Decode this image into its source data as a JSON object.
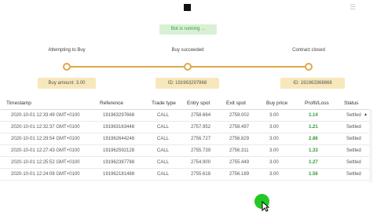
{
  "toolbar": {
    "stop_icon": "stop-square-icon",
    "corner_icon": "settings-icon",
    "corner_glyph": "☰"
  },
  "status": {
    "label": "Bot is running ..."
  },
  "steps": [
    {
      "title": "Attempting to Buy",
      "box": "Buy amount: 3.00"
    },
    {
      "title": "Buy succeeded",
      "box": "ID: 191963297868"
    },
    {
      "title": "Contract closed",
      "box": "ID: 191963368868"
    }
  ],
  "table": {
    "headers": [
      "Timestamp",
      "Reference",
      "Trade type",
      "Entry spot",
      "Exit spot",
      "Buy price",
      "Profit/Loss",
      "Status"
    ],
    "rows": [
      [
        "2020-10-01 12:33:49 GMT+0100",
        "191963297668",
        "CALL",
        "2758.664",
        "2759.002",
        "3.00",
        "1.14",
        "Settled"
      ],
      [
        "2020-10-01 12:32:37 GMT+0100",
        "191963163448",
        "CALL",
        "2757.952",
        "2758.497",
        "3.00",
        "1.21",
        "Settled"
      ],
      [
        "2020-10-01 12:29:54 GMT+0100",
        "191962644248",
        "CALL",
        "2756.727",
        "2756.829",
        "3.00",
        "2.86",
        "Settled"
      ],
      [
        "2020-10-01 12:27:43 GMT+0100",
        "191962592128",
        "CALL",
        "2755.739",
        "2756.311",
        "3.00",
        "1.33",
        "Settled"
      ],
      [
        "2020-10-01 12:25:52 GMT+0100",
        "191962387788",
        "CALL",
        "2754.900",
        "2755.449",
        "3.00",
        "1.27",
        "Settled"
      ],
      [
        "2020-10-01 12:24:08 GMT+0100",
        "191962181488",
        "CALL",
        "2755.618",
        "2756.189",
        "3.00",
        "1.56",
        "Settled"
      ]
    ]
  },
  "colors": {
    "accent": "#e0a84a",
    "profit": "#2e9a3b",
    "status_bg": "#d8f1d5",
    "click_dot": "#22c922"
  }
}
